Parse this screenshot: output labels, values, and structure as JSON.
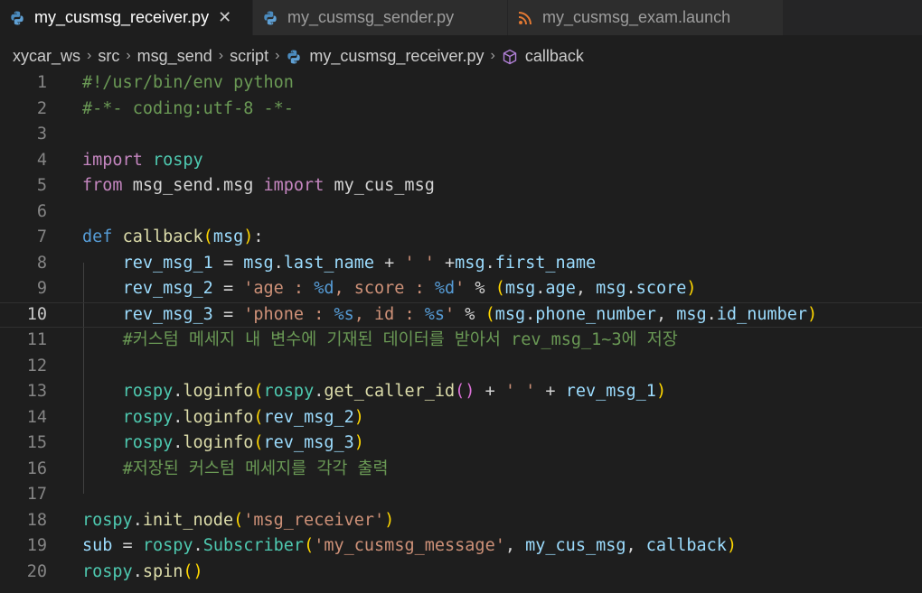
{
  "tabs": [
    {
      "label": "my_cusmsg_receiver.py",
      "icon": "python-icon",
      "active": true,
      "close": "✕"
    },
    {
      "label": "my_cusmsg_sender.py",
      "icon": "python-icon",
      "active": false
    },
    {
      "label": "my_cusmsg_exam.launch",
      "icon": "rss-icon",
      "active": false
    }
  ],
  "breadcrumb": {
    "items": [
      "xycar_ws",
      "src",
      "msg_send",
      "script",
      "my_cusmsg_receiver.py",
      "callback"
    ],
    "separator": "›"
  },
  "editor": {
    "current_line": 10,
    "lines": [
      {
        "n": "1",
        "tokens": [
          [
            "comment",
            "#!/usr/bin/env python"
          ]
        ]
      },
      {
        "n": "2",
        "tokens": [
          [
            "comment",
            "#-*- coding:utf-8 -*-"
          ]
        ]
      },
      {
        "n": "3",
        "tokens": []
      },
      {
        "n": "4",
        "tokens": [
          [
            "kw",
            "import"
          ],
          [
            "plain",
            " "
          ],
          [
            "mod",
            "rospy"
          ]
        ]
      },
      {
        "n": "5",
        "tokens": [
          [
            "kw",
            "from"
          ],
          [
            "plain",
            " msg_send.msg "
          ],
          [
            "kw",
            "import"
          ],
          [
            "plain",
            " my_cus_msg"
          ]
        ]
      },
      {
        "n": "6",
        "tokens": []
      },
      {
        "n": "7",
        "tokens": [
          [
            "def",
            "def"
          ],
          [
            "plain",
            " "
          ],
          [
            "fn",
            "callback"
          ],
          [
            "br1",
            "("
          ],
          [
            "var",
            "msg"
          ],
          [
            "br1",
            ")"
          ],
          [
            "plain",
            ":"
          ]
        ]
      },
      {
        "n": "8",
        "tokens": [
          [
            "plain",
            "    "
          ],
          [
            "var",
            "rev_msg_1"
          ],
          [
            "plain",
            " = "
          ],
          [
            "var",
            "msg"
          ],
          [
            "plain",
            "."
          ],
          [
            "var",
            "last_name"
          ],
          [
            "plain",
            " + "
          ],
          [
            "str",
            "' '"
          ],
          [
            "plain",
            " +"
          ],
          [
            "var",
            "msg"
          ],
          [
            "plain",
            "."
          ],
          [
            "var",
            "first_name"
          ]
        ]
      },
      {
        "n": "9",
        "tokens": [
          [
            "plain",
            "    "
          ],
          [
            "var",
            "rev_msg_2"
          ],
          [
            "plain",
            " = "
          ],
          [
            "str",
            "'age : "
          ],
          [
            "def",
            "%d"
          ],
          [
            "str",
            ", score : "
          ],
          [
            "def",
            "%d"
          ],
          [
            "str",
            "'"
          ],
          [
            "plain",
            " % "
          ],
          [
            "br1",
            "("
          ],
          [
            "var",
            "msg"
          ],
          [
            "plain",
            "."
          ],
          [
            "var",
            "age"
          ],
          [
            "plain",
            ", "
          ],
          [
            "var",
            "msg"
          ],
          [
            "plain",
            "."
          ],
          [
            "var",
            "score"
          ],
          [
            "br1",
            ")"
          ]
        ]
      },
      {
        "n": "10",
        "tokens": [
          [
            "plain",
            "    "
          ],
          [
            "var",
            "rev_msg_3"
          ],
          [
            "plain",
            " = "
          ],
          [
            "str",
            "'phone : "
          ],
          [
            "def",
            "%s"
          ],
          [
            "str",
            ", id : "
          ],
          [
            "def",
            "%s"
          ],
          [
            "str",
            "'"
          ],
          [
            "plain",
            " % "
          ],
          [
            "br1",
            "("
          ],
          [
            "var",
            "msg"
          ],
          [
            "plain",
            "."
          ],
          [
            "var",
            "phone_number"
          ],
          [
            "plain",
            ", "
          ],
          [
            "var",
            "msg"
          ],
          [
            "plain",
            "."
          ],
          [
            "var",
            "id_number"
          ],
          [
            "br1",
            ")"
          ]
        ]
      },
      {
        "n": "11",
        "tokens": [
          [
            "plain",
            "    "
          ],
          [
            "comment",
            "#커스텀 메세지 내 변수에 기재된 데이터를 받아서 rev_msg_1~3에 저장"
          ]
        ]
      },
      {
        "n": "12",
        "tokens": []
      },
      {
        "n": "13",
        "tokens": [
          [
            "plain",
            "    "
          ],
          [
            "mod",
            "rospy"
          ],
          [
            "plain",
            "."
          ],
          [
            "fn",
            "loginfo"
          ],
          [
            "br1",
            "("
          ],
          [
            "mod",
            "rospy"
          ],
          [
            "plain",
            "."
          ],
          [
            "fn",
            "get_caller_id"
          ],
          [
            "br2",
            "()"
          ],
          [
            "plain",
            " + "
          ],
          [
            "str",
            "' '"
          ],
          [
            "plain",
            " + "
          ],
          [
            "var",
            "rev_msg_1"
          ],
          [
            "br1",
            ")"
          ]
        ]
      },
      {
        "n": "14",
        "tokens": [
          [
            "plain",
            "    "
          ],
          [
            "mod",
            "rospy"
          ],
          [
            "plain",
            "."
          ],
          [
            "fn",
            "loginfo"
          ],
          [
            "br1",
            "("
          ],
          [
            "var",
            "rev_msg_2"
          ],
          [
            "br1",
            ")"
          ]
        ]
      },
      {
        "n": "15",
        "tokens": [
          [
            "plain",
            "    "
          ],
          [
            "mod",
            "rospy"
          ],
          [
            "plain",
            "."
          ],
          [
            "fn",
            "loginfo"
          ],
          [
            "br1",
            "("
          ],
          [
            "var",
            "rev_msg_3"
          ],
          [
            "br1",
            ")"
          ]
        ]
      },
      {
        "n": "16",
        "tokens": [
          [
            "plain",
            "    "
          ],
          [
            "comment",
            "#저장된 커스텀 메세지를 각각 출력"
          ]
        ]
      },
      {
        "n": "17",
        "tokens": []
      },
      {
        "n": "18",
        "tokens": [
          [
            "mod",
            "rospy"
          ],
          [
            "plain",
            "."
          ],
          [
            "fn",
            "init_node"
          ],
          [
            "br1",
            "("
          ],
          [
            "str",
            "'msg_receiver'"
          ],
          [
            "br1",
            ")"
          ]
        ]
      },
      {
        "n": "19",
        "tokens": [
          [
            "var",
            "sub"
          ],
          [
            "plain",
            " = "
          ],
          [
            "mod",
            "rospy"
          ],
          [
            "plain",
            "."
          ],
          [
            "mod",
            "Subscriber"
          ],
          [
            "br1",
            "("
          ],
          [
            "str",
            "'my_cusmsg_message'"
          ],
          [
            "plain",
            ", "
          ],
          [
            "var",
            "my_cus_msg"
          ],
          [
            "plain",
            ", "
          ],
          [
            "var",
            "callback"
          ],
          [
            "br1",
            ")"
          ]
        ]
      },
      {
        "n": "20",
        "tokens": [
          [
            "mod",
            "rospy"
          ],
          [
            "plain",
            "."
          ],
          [
            "fn",
            "spin"
          ],
          [
            "br1",
            "()"
          ]
        ]
      }
    ]
  },
  "colors": {
    "background": "#1e1e1e",
    "tabbar": "#252526",
    "comment": "#6a9955",
    "keyword": "#c586c0",
    "string": "#ce9178",
    "function": "#dcdcaa",
    "variable": "#9cdcfe"
  }
}
